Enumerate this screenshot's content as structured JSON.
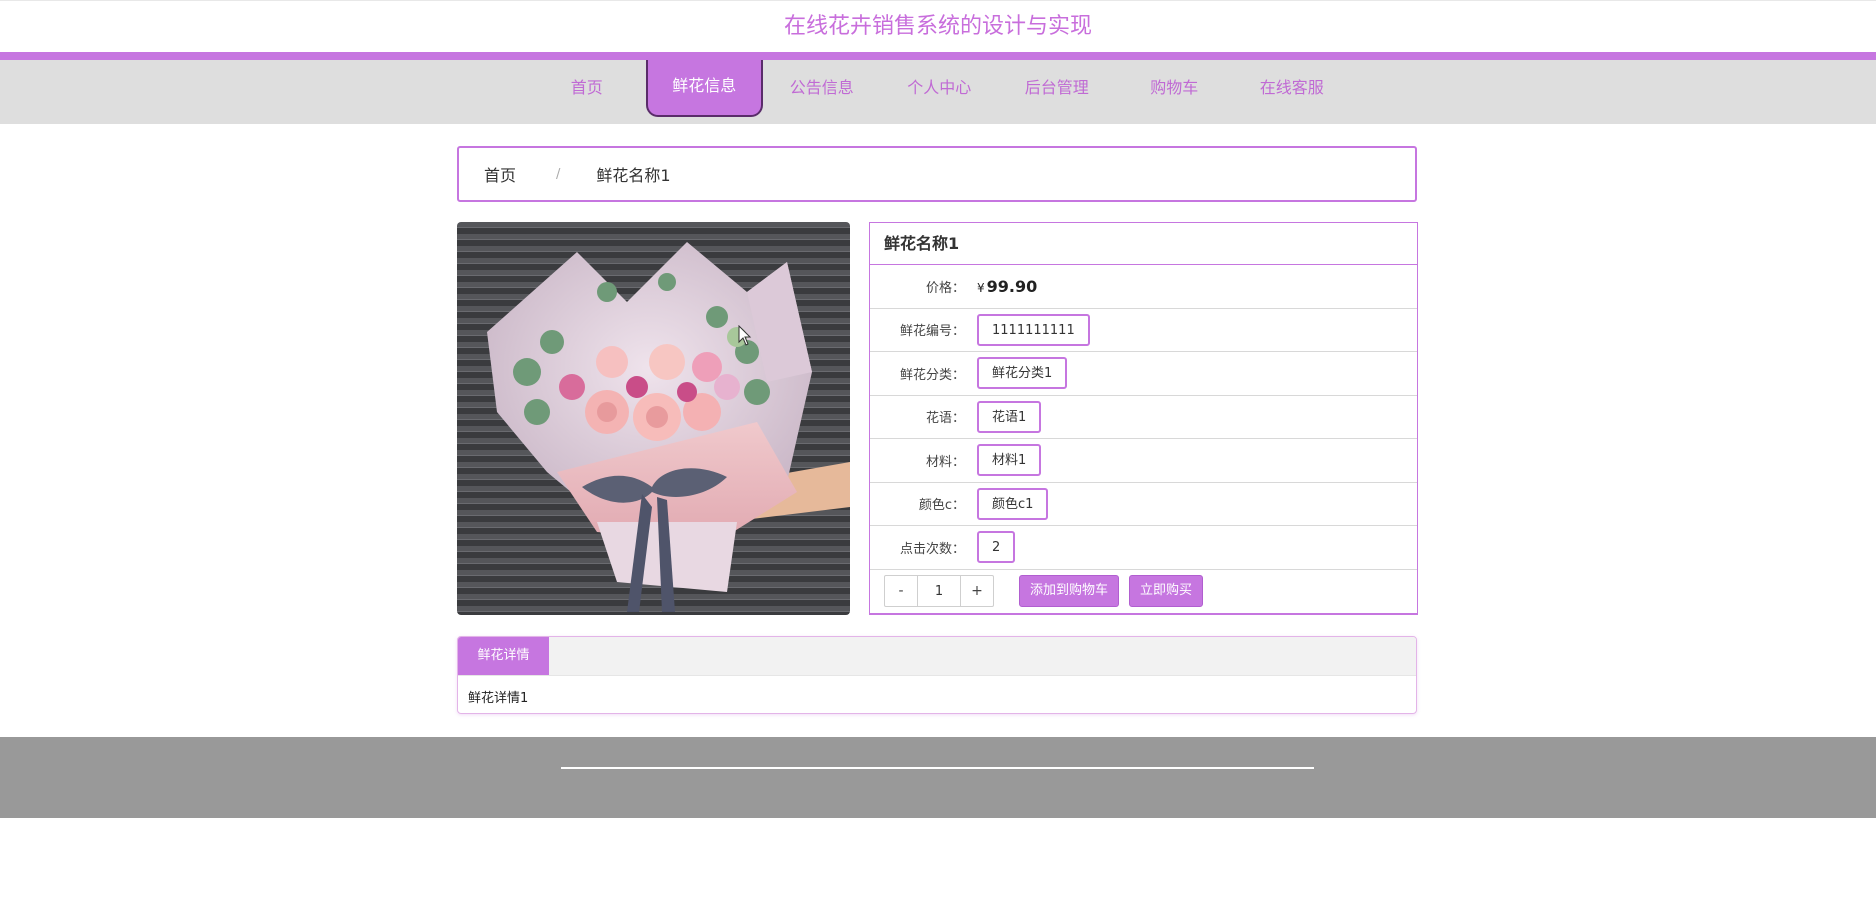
{
  "site": {
    "title": "在线花卉销售系统的设计与实现"
  },
  "nav": {
    "items": [
      {
        "label": "首页"
      },
      {
        "label": "鲜花信息"
      },
      {
        "label": "公告信息"
      },
      {
        "label": "个人中心"
      },
      {
        "label": "后台管理"
      },
      {
        "label": "购物车"
      },
      {
        "label": "在线客服"
      }
    ],
    "active": "鲜花信息"
  },
  "breadcrumb": {
    "home": "首页",
    "separator": "/",
    "current": "鲜花名称1"
  },
  "product": {
    "name": "鲜花名称1",
    "price_label": "价格：",
    "currency": "¥",
    "price": "99.90",
    "fields": [
      {
        "label": "鲜花编号：",
        "value": "1111111111"
      },
      {
        "label": "鲜花分类：",
        "value": "鲜花分类1"
      },
      {
        "label": "花语：",
        "value": "花语1"
      },
      {
        "label": "材料：",
        "value": "材料1"
      },
      {
        "label": "颜色c：",
        "value": "颜色c1"
      },
      {
        "label": "点击次数：",
        "value": "2"
      }
    ],
    "quantity": {
      "minus": "-",
      "value": "1",
      "plus": "+"
    },
    "add_to_cart": "添加到购物车",
    "buy_now": "立即购买"
  },
  "details": {
    "tab": "鲜花详情",
    "content": "鲜花详情1"
  },
  "colors": {
    "accent": "#c676e0",
    "title": "#c86edc",
    "nav_bg": "#dedede",
    "footer_bg": "#999999"
  },
  "icons": {
    "cursor": "mouse-pointer-icon"
  }
}
